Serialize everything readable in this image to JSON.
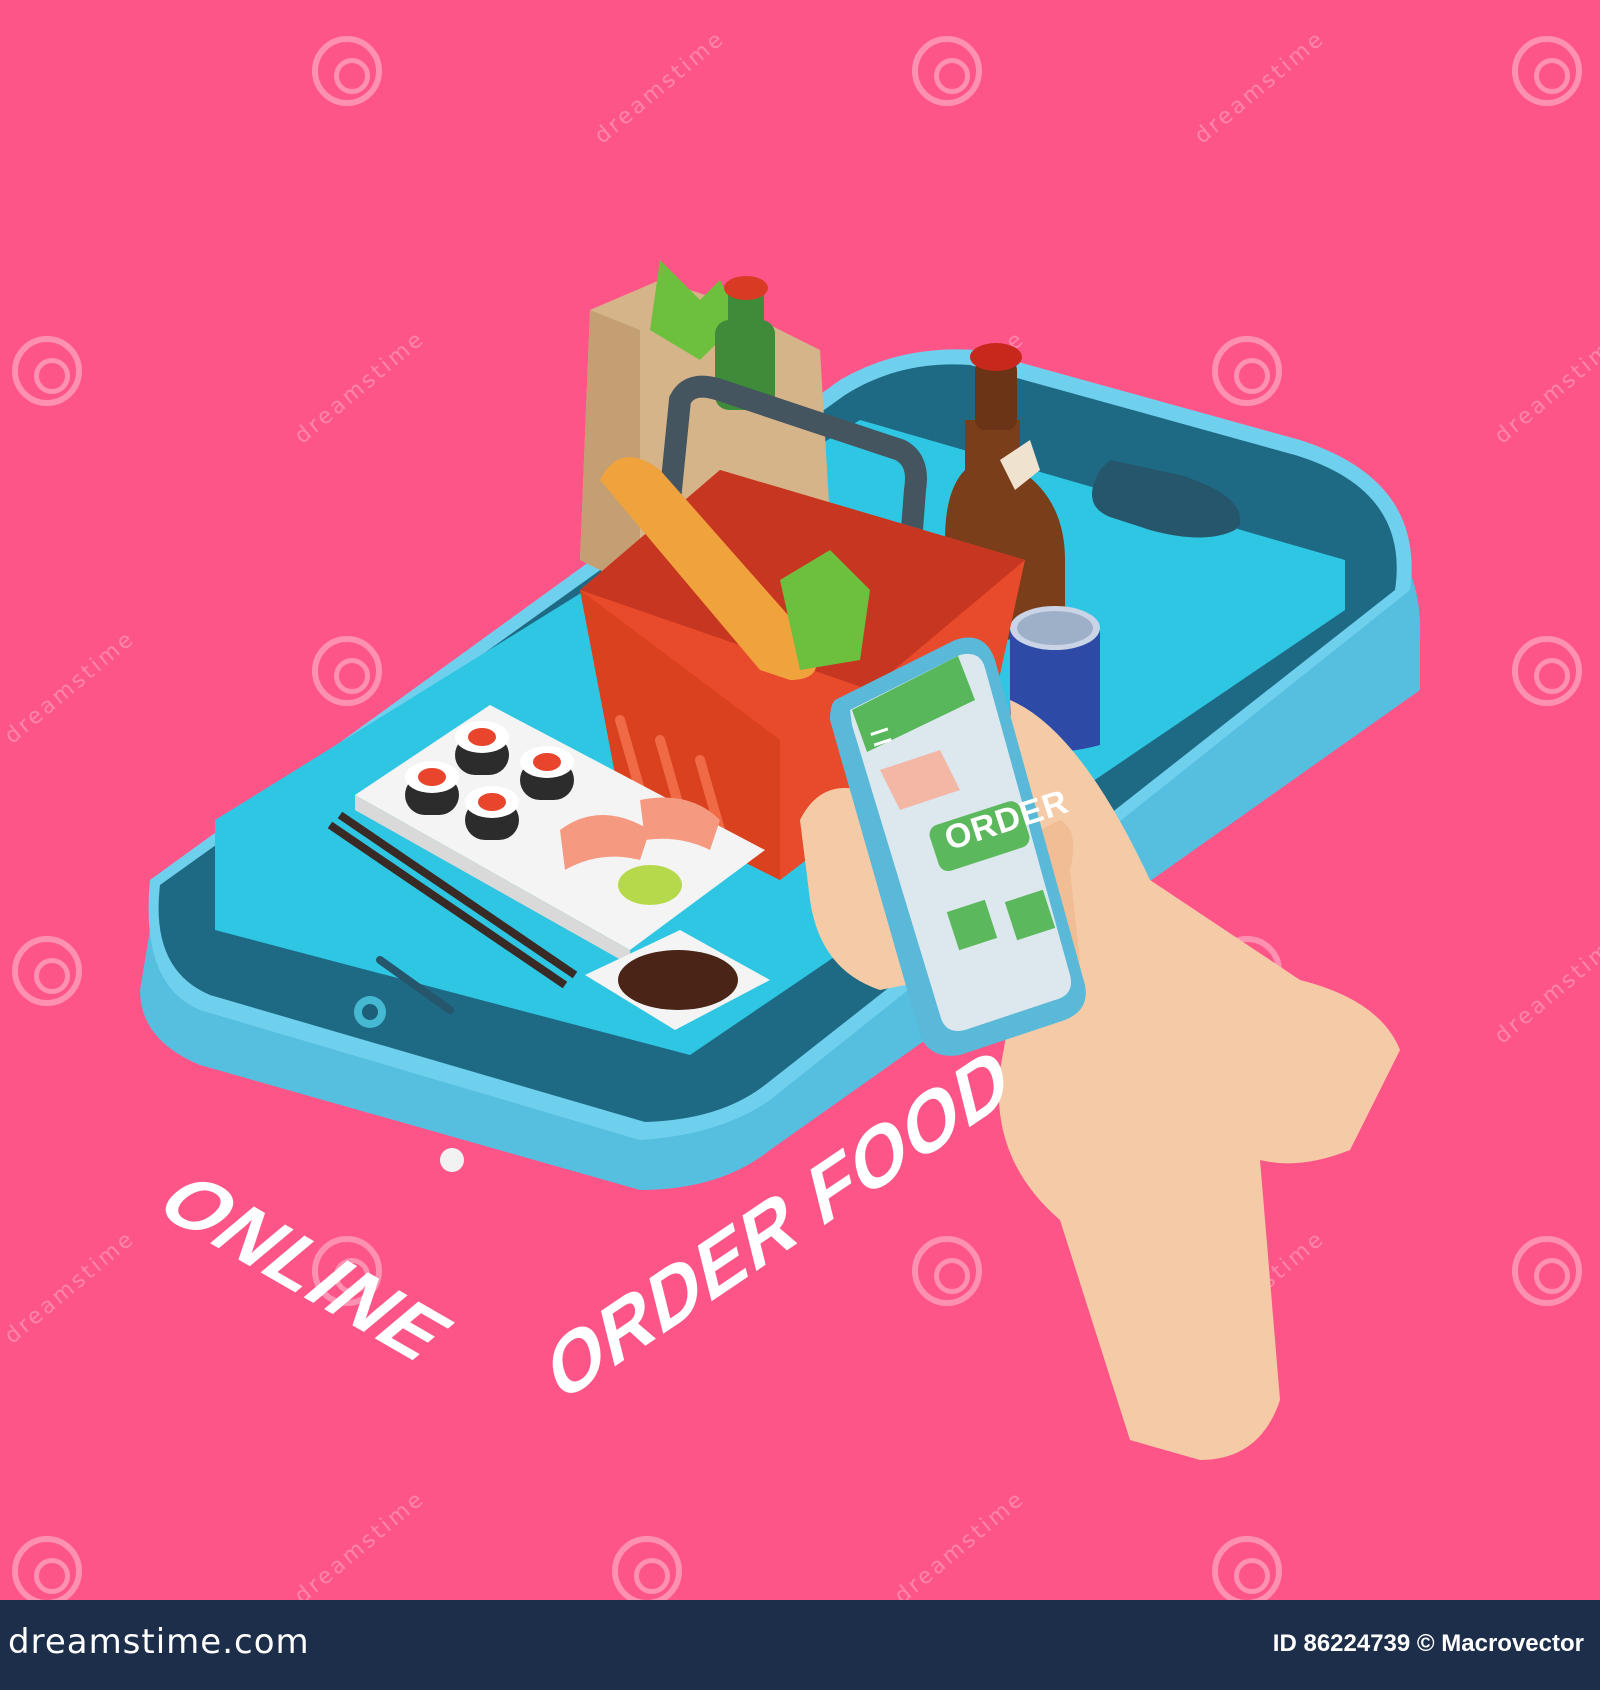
{
  "headline": {
    "word1": "ONLINE",
    "word2": "ORDER FOOD"
  },
  "small_phone": {
    "order_button_label": "ORDER"
  },
  "watermark": {
    "text": "dreamstime"
  },
  "footer": {
    "site": "dreamstime.com",
    "id_credit": "ID 86224739 © Macrovector"
  },
  "colors": {
    "background": "#fe5589",
    "footer_background": "#1c2e4a",
    "phone_body": "#5ec6e6",
    "screen": "#33c2e0",
    "basket": "#e84b2b",
    "order_button": "#5cb85c"
  },
  "icons": [
    "swirl-watermark-icon",
    "menu-icon"
  ]
}
